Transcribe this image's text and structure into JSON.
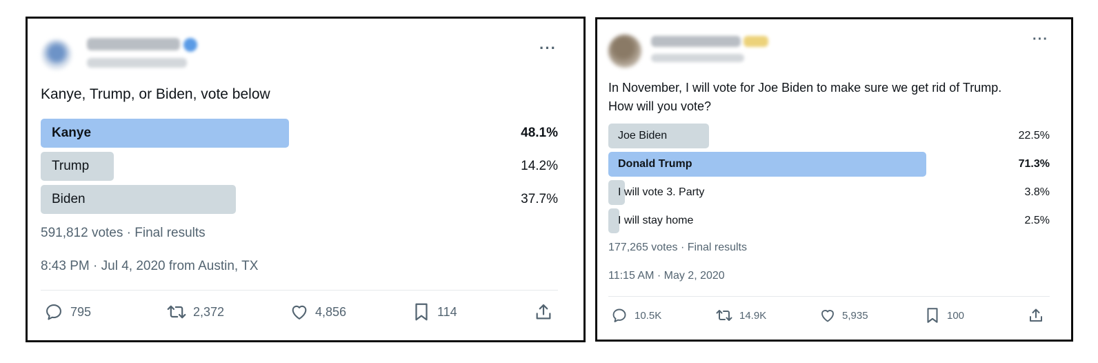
{
  "tweet1": {
    "text": "Kanye, Trump, or Biden, vote below",
    "poll": [
      {
        "label": "Kanye",
        "pct_text": "48.1%",
        "pct": 48.1,
        "winner": true
      },
      {
        "label": "Trump",
        "pct_text": "14.2%",
        "pct": 14.2,
        "winner": false
      },
      {
        "label": "Biden",
        "pct_text": "37.7%",
        "pct": 37.7,
        "winner": false
      }
    ],
    "votes": "591,812 votes · Final results",
    "timestamp": "8:43 PM · Jul 4, 2020 from Austin, TX",
    "actions": {
      "replies": "795",
      "reposts": "2,372",
      "likes": "4,856",
      "bookmarks": "114"
    },
    "icons": {
      "more": "more-options-icon",
      "reply": "reply-icon",
      "repost": "repost-icon",
      "like": "heart-icon",
      "bookmark": "bookmark-icon",
      "share": "share-icon"
    }
  },
  "tweet2": {
    "text_line1": "In November, I will vote for Joe Biden to make sure we get rid of Trump.",
    "text_line2": "How will you vote?",
    "poll": [
      {
        "label": "Joe Biden",
        "pct_text": "22.5%",
        "pct": 22.5,
        "winner": false
      },
      {
        "label": "Donald Trump",
        "pct_text": "71.3%",
        "pct": 71.3,
        "winner": true
      },
      {
        "label": "I will vote 3. Party",
        "pct_text": "3.8%",
        "pct": 3.8,
        "winner": false
      },
      {
        "label": "I will stay home",
        "pct_text": "2.5%",
        "pct": 2.5,
        "winner": false
      }
    ],
    "votes": "177,265 votes · Final results",
    "timestamp": "11:15 AM · May 2, 2020",
    "actions": {
      "replies": "10.5K",
      "reposts": "14.9K",
      "likes": "5,935",
      "bookmarks": "100"
    },
    "icons": {
      "more": "more-options-icon",
      "reply": "reply-icon",
      "repost": "repost-icon",
      "like": "heart-icon",
      "bookmark": "bookmark-icon",
      "share": "share-icon"
    }
  },
  "more_glyph": "···",
  "colors": {
    "winner_bar": "#9dc3f1",
    "option_bar": "#cfd9de",
    "muted_text": "#536471",
    "card_border": "#0b0b0b"
  }
}
